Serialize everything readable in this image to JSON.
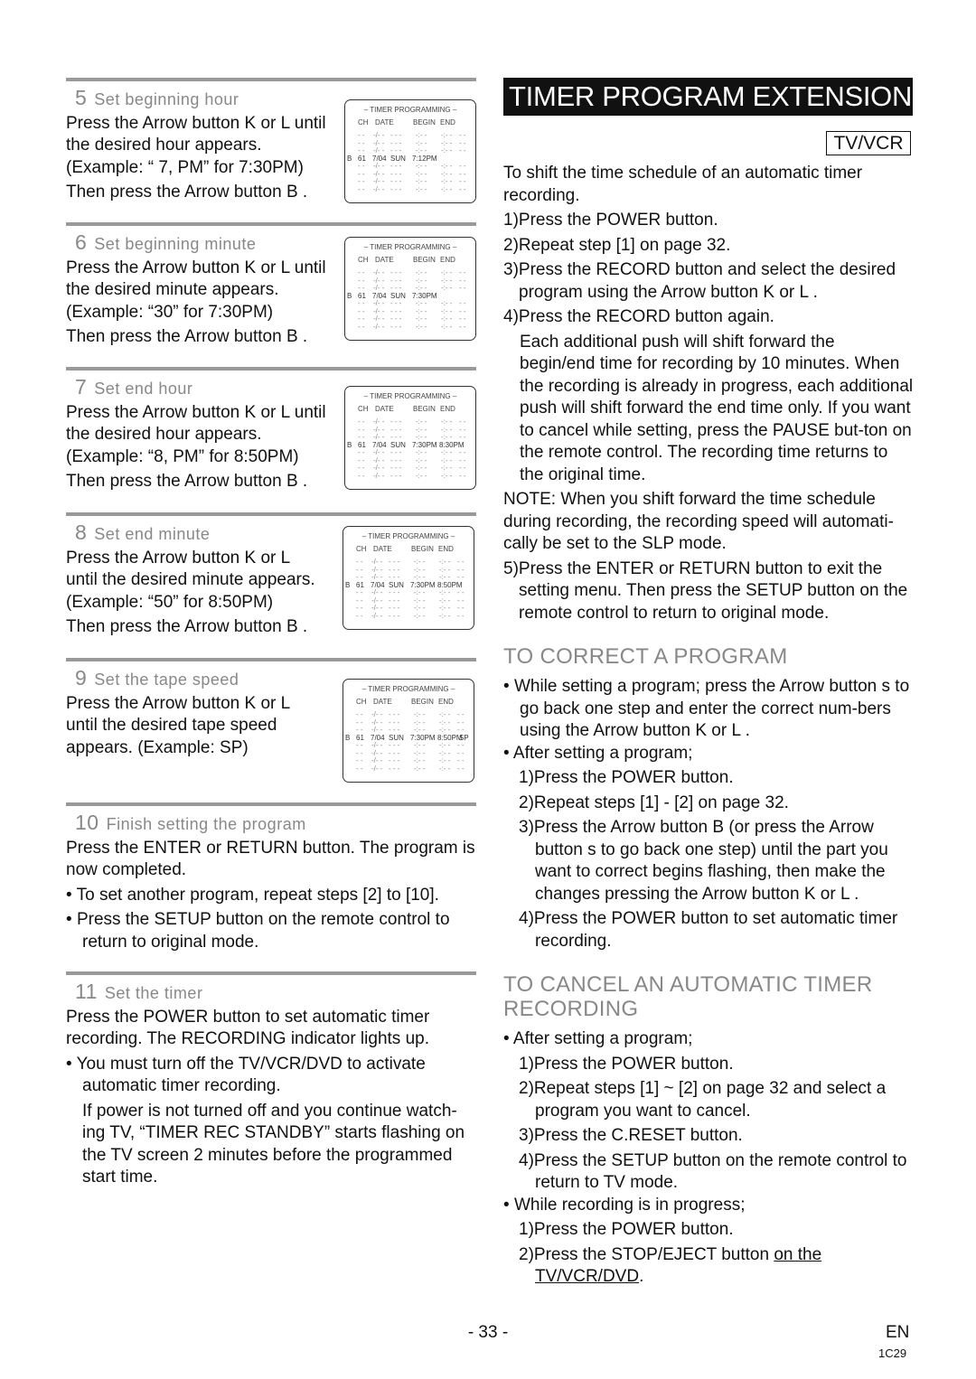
{
  "steps": [
    {
      "num": "5",
      "title": "Set beginning hour",
      "lines": [
        "Press the Arrow button K or L until",
        "the desired hour appears.",
        "(Example: “ 7, PM” for 7:30PM)",
        "Then press the Arrow button B ."
      ]
    },
    {
      "num": "6",
      "title": "Set beginning minute",
      "lines": [
        "Press the Arrow button K or L until",
        "the desired minute appears.",
        "(Example: “30” for 7:30PM)",
        "Then press the Arrow button B ."
      ]
    },
    {
      "num": "7",
      "title": "Set end hour",
      "lines": [
        "Press the Arrow button K or L until",
        "the desired hour appears.",
        "(Example: “8, PM” for 8:50PM)",
        "Then press the Arrow button B ."
      ]
    },
    {
      "num": "8",
      "title": "Set end minute",
      "lines": [
        "Press the Arrow button K or L",
        "until the desired minute appears.",
        "(Example: “50” for 8:50PM)",
        "Then press the Arrow button B ."
      ]
    },
    {
      "num": "9",
      "title": "Set the tape speed",
      "lines": [
        "Press the Arrow button K or L",
        "until the desired tape speed",
        "appears. (Example: SP)"
      ]
    },
    {
      "num": "10",
      "title": "Finish setting the program",
      "lines": [
        "Press the ENTER or RETURN button. The program is now completed."
      ],
      "bullets": [
        "To set another program, repeat steps [2] to [10].",
        "Press the SETUP button on the remote control to return to original mode."
      ]
    },
    {
      "num": "11",
      "title": "Set the timer",
      "lines": [
        "Press the POWER button to set automatic timer recording. The RECORDING indicator lights up."
      ],
      "bullets": [
        "You must turn off the TV/VCR/DVD to activate automatic timer recording."
      ],
      "note": "If power is not turned off and you continue watch-ing TV, “TIMER REC STANDBY” starts flashing on the TV screen 2 minutes before the programmed start time."
    }
  ],
  "screen": {
    "title": "– TIMER PROGRAMMING –",
    "cols": [
      "CH",
      "DATE",
      "BEGIN",
      "END"
    ],
    "empty": [
      "- -",
      "-/- -",
      "- - -",
      "-:- -",
      "-:- -",
      "- -"
    ],
    "marker": "B",
    "ch": "61",
    "date": "7/04",
    "day": "SUN",
    "states": [
      {
        "begin": "7:12PM",
        "end": "",
        "speed": ""
      },
      {
        "begin": "7:30PM",
        "end": "",
        "speed": ""
      },
      {
        "begin": "7:30PM",
        "end": "8:30PM",
        "speed": ""
      },
      {
        "begin": "7:30PM",
        "end": "8:50PM",
        "speed": ""
      },
      {
        "begin": "7:30PM",
        "end": "8:50PM",
        "speed": "SP"
      }
    ]
  },
  "right": {
    "title": "TIMER PROGRAM EXTENSION",
    "badge": "TV/VCR",
    "intro": "To shift the time schedule of an automatic timer recording.",
    "steps": [
      "1)Press the POWER button.",
      "2)Repeat step [1] on page 32.",
      "3)Press the RECORD button and select the desired program using the Arrow button K or L .",
      "4)Press the RECORD button again."
    ],
    "step4_detail": "Each additional push will shift forward the begin/end time for recording by 10 minutes. When the recording is already in progress, each additional push will shift forward the end time only. If you want to cancel while setting, press the PAUSE but-ton on the remote control. The recording time returns to the original time.",
    "note": "NOTE: When you shift forward the time schedule during recording, the recording speed will automati-cally be set to the SLP mode.",
    "step5": "5)Press the ENTER or RETURN button to exit the setting menu. Then press the SETUP button on the remote control to return to original mode.",
    "correct_title": "TO CORRECT A PROGRAM",
    "correct_b1": "While setting a program; press the Arrow button s to go back one step and enter the correct num-bers using the Arrow button K or L .",
    "correct_b2": "After setting a program;",
    "correct_steps": [
      "1)Press the POWER button.",
      "2)Repeat steps [1] - [2] on page 32.",
      "3)Press the Arrow button B (or press the Arrow button s to go back one step) until the part you want to correct begins flashing, then make the changes pressing the Arrow button K or L .",
      "4)Press the POWER button to set automatic timer recording."
    ],
    "cancel_title": "TO CANCEL AN AUTOMATIC TIMER RECORDING",
    "cancel_b1": "After setting a program;",
    "cancel_steps1": [
      "1)Press the POWER button.",
      "2)Repeat steps [1] ~ [2] on page 32 and select a program you want to cancel.",
      "3)Press the C.RESET button.",
      "4)Press the SETUP button on the remote control to return to TV mode."
    ],
    "cancel_b2": "While recording is in progress;",
    "cancel_steps2": [
      "1)Press the POWER button."
    ],
    "cancel_last_a": "2)Press the STOP/EJECT button ",
    "cancel_last_b": "on the TV/VCR/DVD",
    "cancel_last_c": "."
  },
  "footer": {
    "page": "- 33 -",
    "lang": "EN",
    "code": "1C29"
  }
}
